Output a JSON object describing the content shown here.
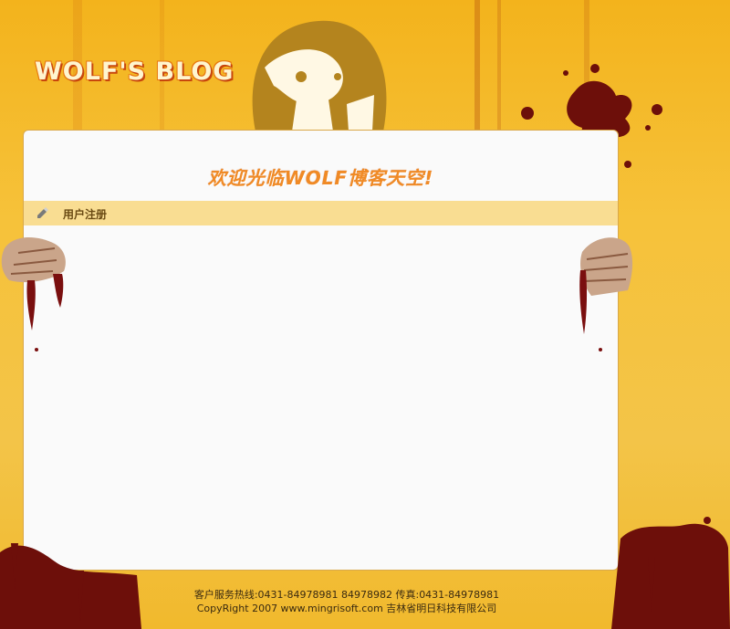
{
  "header": {
    "logo_text": "WOLF'S BLOG"
  },
  "panel": {
    "welcome_text": "欢迎光临WOLF博客天空!",
    "section_title": "用户注册"
  },
  "footer": {
    "line1": "客户服务热线:0431-84978981 84978982 传真:0431-84978981",
    "line2": "CopyRight 2007 www.mingrisoft.com 吉林省明日科技有限公司"
  },
  "colors": {
    "background": "#f3b31c",
    "panel": "#fafafa",
    "section_bar": "#f9dd92",
    "welcome_text": "#f08a25",
    "blood": "#7a0f0f"
  }
}
